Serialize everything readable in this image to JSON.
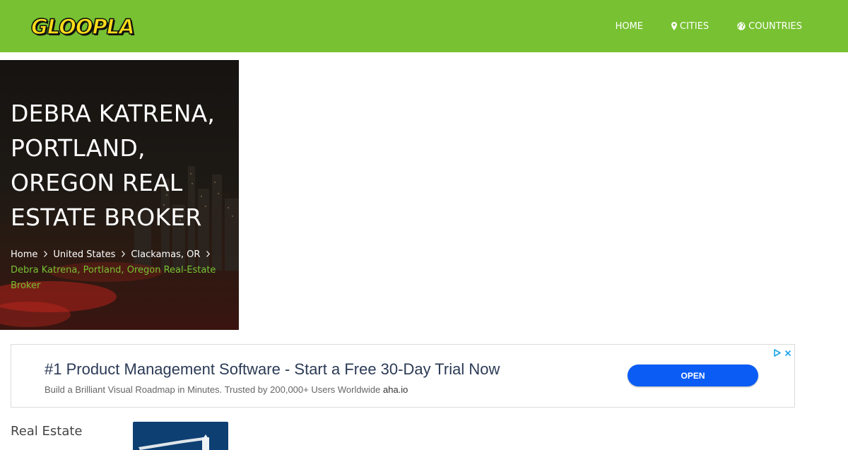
{
  "brand": {
    "logo_text": "GLOOPLA",
    "accent": "#78c132",
    "ad_button": "#0a5cf5"
  },
  "nav": {
    "items": [
      {
        "label": "HOME",
        "icon": ""
      },
      {
        "label": "CITIES",
        "icon": "map-marker-icon"
      },
      {
        "label": "COUNTRIES",
        "icon": "globe-icon"
      }
    ]
  },
  "hero": {
    "title": "DEBRA KATRENA, PORTLAND, OREGON REAL ESTATE BROKER",
    "breadcrumb": [
      {
        "label": "Home"
      },
      {
        "label": "United States"
      },
      {
        "label": "Clackamas, OR"
      }
    ],
    "current": "Debra Katrena, Portland, Oregon Real-Estate Broker"
  },
  "ad": {
    "title": "#1 Product Management Software - Start a Free 30-Day Trial Now",
    "description": "Build a Brilliant Visual Roadmap in Minutes. Trusted by 200,000+ Users Worldwide",
    "domain": "aha.io",
    "button": "OPEN",
    "icons": [
      "adchoices-icon",
      "close-icon"
    ]
  },
  "content": {
    "category": "Real Estate"
  }
}
